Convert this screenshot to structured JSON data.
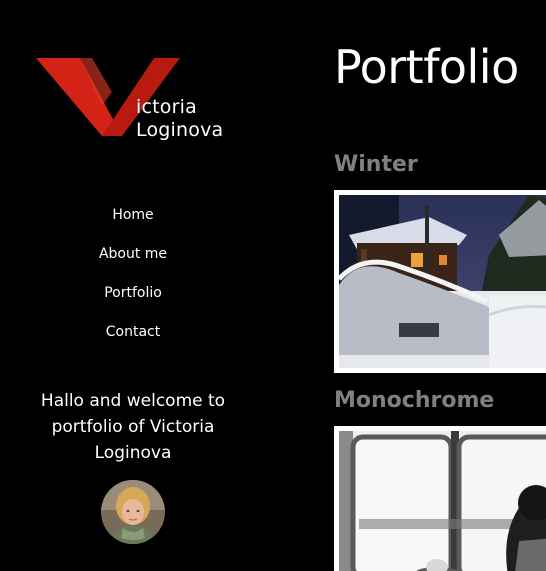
{
  "logo": {
    "line1": "ictoria",
    "line2": "Loginova",
    "colors": {
      "red": "#d32316",
      "dark_red": "#a8170f"
    }
  },
  "nav": {
    "items": [
      {
        "label": "Home"
      },
      {
        "label": "About me"
      },
      {
        "label": "Portfolio"
      },
      {
        "label": "Contact"
      }
    ]
  },
  "sidebar": {
    "welcome_text": "Hallo and welcome to portfolio of Victoria Loginova"
  },
  "main": {
    "title": "Portfolio",
    "sections": [
      {
        "title": "Winter"
      },
      {
        "title": "Monochrome"
      }
    ]
  },
  "colors": {
    "background": "#000000",
    "text": "#ffffff",
    "section_title": "#808080",
    "frame": "#ffffff"
  }
}
